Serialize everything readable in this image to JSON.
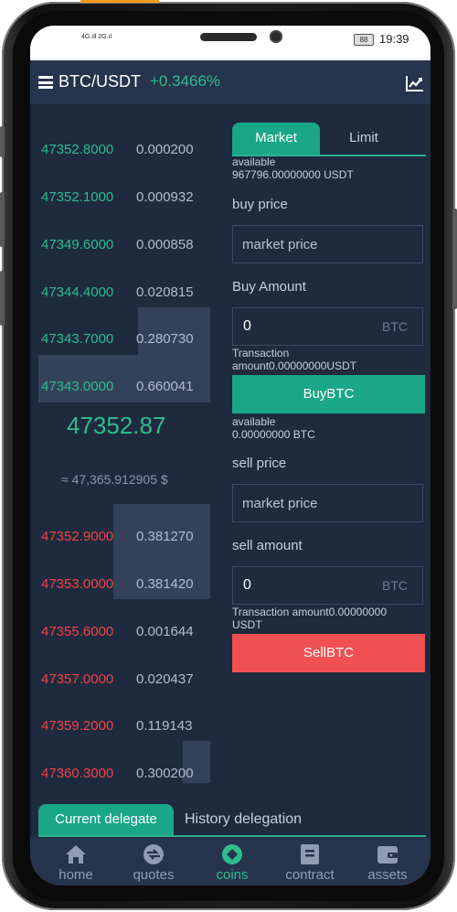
{
  "status": {
    "signal": "4G.ıll 2G.ıl",
    "battery": "88",
    "time": "19:39"
  },
  "header": {
    "pair": "BTC/USDT",
    "change": "+0.3466%"
  },
  "orderbook": {
    "asks": [
      {
        "price": "47352.8000",
        "amount": "0.000200"
      },
      {
        "price": "47352.1000",
        "amount": "0.000932"
      },
      {
        "price": "47349.6000",
        "amount": "0.000858"
      },
      {
        "price": "47344.4000",
        "amount": "0.020815"
      },
      {
        "price": "47343.7000",
        "amount": "0.280730"
      },
      {
        "price": "47343.0000",
        "amount": "0.660041"
      }
    ],
    "last_price": "47352.87",
    "last_usd": "≈ 47,365.912905 $",
    "bids": [
      {
        "price": "47352.9000",
        "amount": "0.381270"
      },
      {
        "price": "47353.0000",
        "amount": "0.381420"
      },
      {
        "price": "47355.6000",
        "amount": "0.001644"
      },
      {
        "price": "47357.0000",
        "amount": "0.020437"
      },
      {
        "price": "47359.2000",
        "amount": "0.119143"
      },
      {
        "price": "47360.3000",
        "amount": "0.300200"
      }
    ]
  },
  "trade": {
    "tabs": [
      "Market",
      "Limit"
    ],
    "buy": {
      "available_label": "available",
      "available_value": "967796.00000000  USDT",
      "price_label": "buy price",
      "price_placeholder": "market price",
      "amount_label": "Buy Amount",
      "amount_value": "0",
      "amount_unit": "BTC",
      "transaction_line1": "Transaction",
      "transaction_line2": "amount0.00000000USDT",
      "button": "BuyBTC"
    },
    "sell": {
      "available_label": "available",
      "available_value": "0.00000000  BTC",
      "price_label": "sell price",
      "price_placeholder": "market price",
      "amount_label": "sell amount",
      "amount_value": "0",
      "amount_unit": "BTC",
      "transaction_line1": "Transaction amount0.00000000",
      "transaction_line2": "USDT",
      "button": "SellBTC"
    }
  },
  "delegation": {
    "current": "Current delegate",
    "history": "History delegation"
  },
  "nav": [
    {
      "label": "home",
      "icon": "home-icon"
    },
    {
      "label": "quotes",
      "icon": "quotes-icon"
    },
    {
      "label": "coins",
      "icon": "coins-icon",
      "active": true
    },
    {
      "label": "contract",
      "icon": "contract-icon"
    },
    {
      "label": "assets",
      "icon": "wallet-icon"
    }
  ],
  "colors": {
    "buy": "#1aa787",
    "sell": "#ef5051",
    "background": "#1e2a3e",
    "header": "#26344d"
  }
}
